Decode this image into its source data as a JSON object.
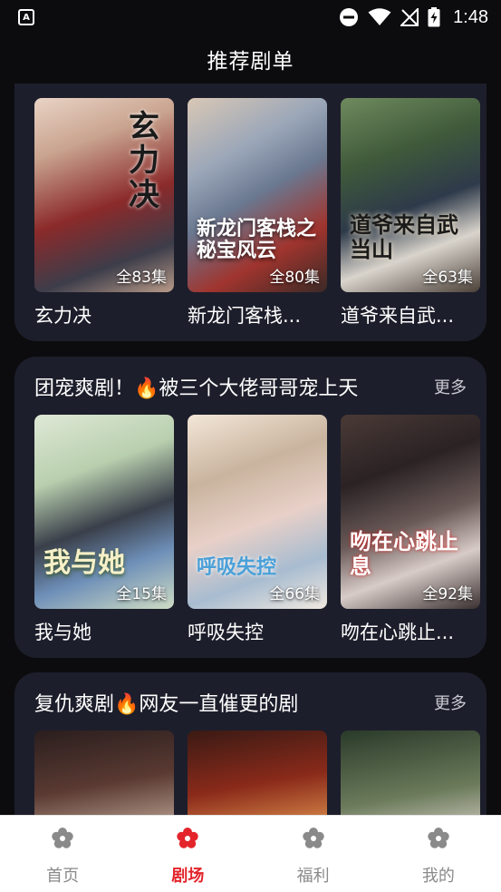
{
  "status_bar": {
    "time": "1:48",
    "app_badge": "A"
  },
  "header": {
    "title": "推荐剧单"
  },
  "sections": [
    {
      "title": "",
      "more_label": "",
      "items": [
        {
          "title": "玄力决",
          "episodes": "全83集",
          "poster_text": "玄力决"
        },
        {
          "title": "新龙门客栈...",
          "episodes": "全80集",
          "poster_text": "新龙门客栈之秘宝风云"
        },
        {
          "title": "道爷来自武...",
          "episodes": "全63集",
          "poster_text": "道爷来自武当山"
        }
      ]
    },
    {
      "title": "团宠爽剧！🔥被三个大佬哥哥宠上天",
      "more_label": "更多",
      "items": [
        {
          "title": "我与她",
          "episodes": "全15集",
          "poster_text": "我与她"
        },
        {
          "title": "呼吸失控",
          "episodes": "全66集",
          "poster_text": "呼吸失控"
        },
        {
          "title": "吻在心跳止...",
          "episodes": "全92集",
          "poster_text": "吻在心跳止息"
        }
      ]
    },
    {
      "title": "复仇爽剧🔥网友一直催更的剧",
      "more_label": "更多",
      "items": [
        {
          "title": "",
          "episodes": "",
          "poster_text": ""
        },
        {
          "title": "",
          "episodes": "",
          "poster_text": ""
        },
        {
          "title": "",
          "episodes": "",
          "poster_text": ""
        }
      ]
    }
  ],
  "bottom_nav": [
    {
      "label": "首页",
      "icon": "flower-icon",
      "active": false
    },
    {
      "label": "剧场",
      "icon": "flower-icon",
      "active": true
    },
    {
      "label": "福利",
      "icon": "flower-icon",
      "active": false
    },
    {
      "label": "我的",
      "icon": "flower-icon",
      "active": false
    }
  ],
  "colors": {
    "accent": "#e3242b",
    "card_bg": "#1d1e2b",
    "page_bg": "#0c0c0e",
    "inactive": "#8a8a8a"
  }
}
